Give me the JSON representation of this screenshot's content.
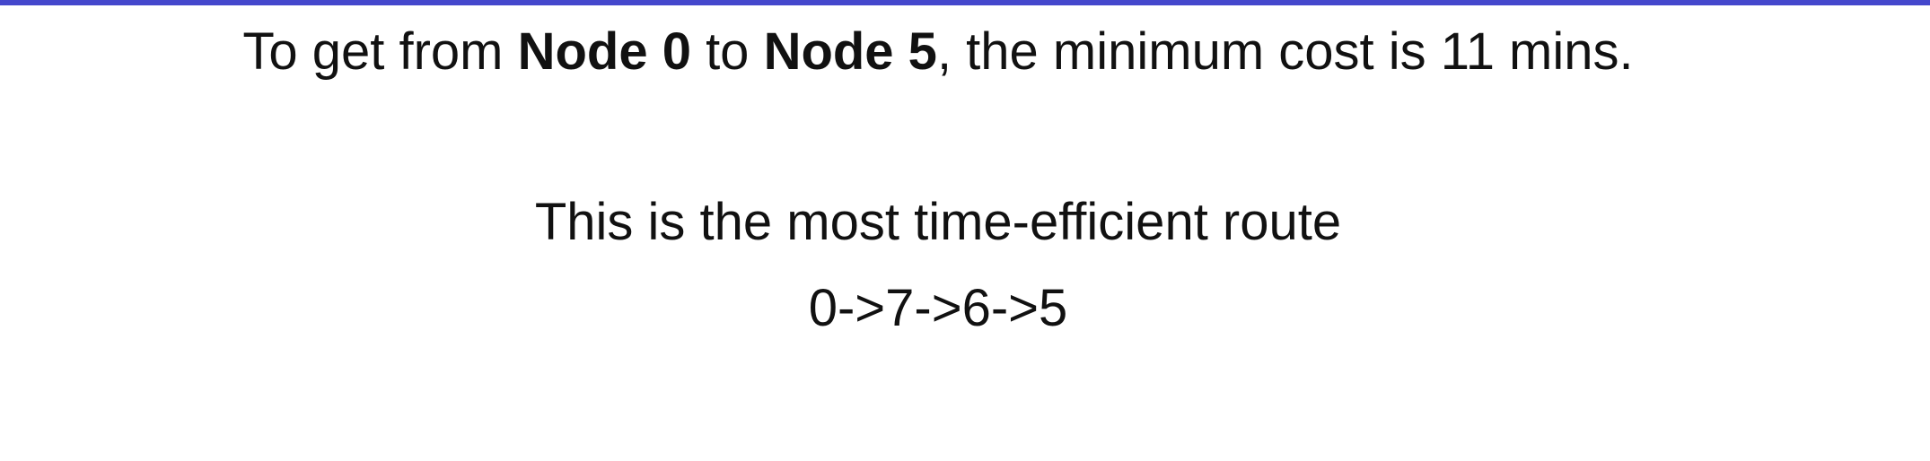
{
  "header": {
    "accent_color": "#4447cc"
  },
  "result": {
    "prefix": "To get from ",
    "start_node": "Node 0",
    "connector": " to ",
    "end_node": "Node 5",
    "suffix": ", the minimum cost is 11 mins."
  },
  "route": {
    "heading": "This is the most time-efficient route",
    "path": "0->7->6->5"
  }
}
